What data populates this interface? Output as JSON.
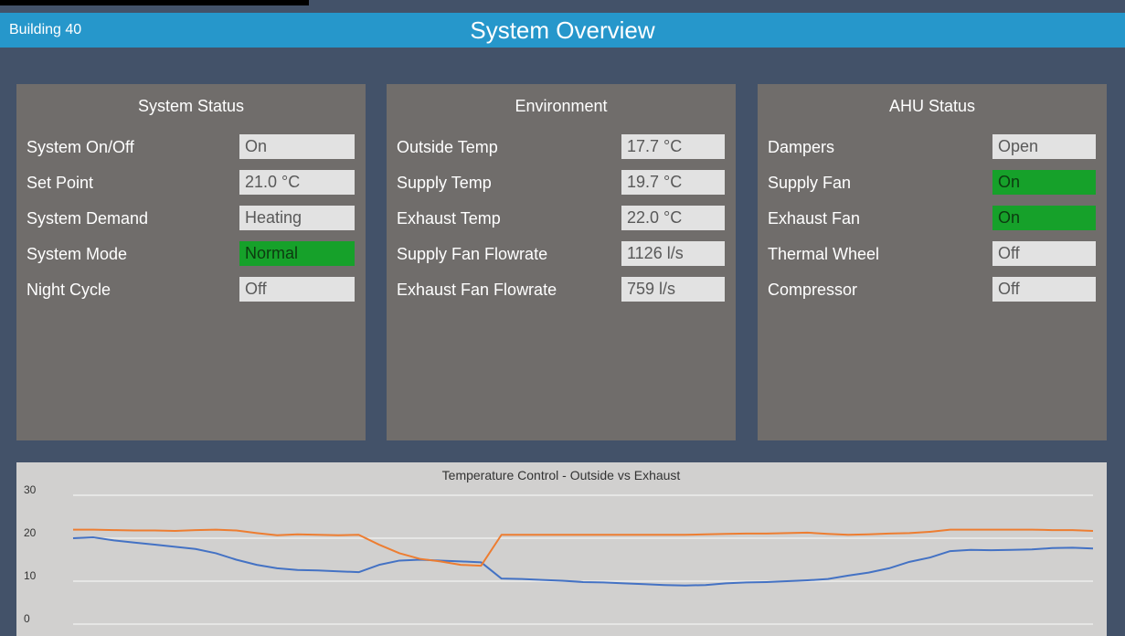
{
  "header": {
    "building": "Building 40",
    "title": "System Overview"
  },
  "panels": {
    "system_status": {
      "title": "System Status",
      "rows": [
        {
          "label": "System On/Off",
          "value": "On"
        },
        {
          "label": "Set Point",
          "value": "21.0 °C"
        },
        {
          "label": "System Demand",
          "value": "Heating"
        },
        {
          "label": "System Mode",
          "value": "Normal"
        },
        {
          "label": "Night Cycle",
          "value": "Off"
        }
      ]
    },
    "environment": {
      "title": "Environment",
      "rows": [
        {
          "label": "Outside Temp",
          "value": "17.7 °C"
        },
        {
          "label": "Supply Temp",
          "value": "19.7 °C"
        },
        {
          "label": "Exhaust Temp",
          "value": "22.0 °C"
        },
        {
          "label": "Supply Fan Flowrate",
          "value": "1126 l/s"
        },
        {
          "label": "Exhaust Fan Flowrate",
          "value": "759 l/s"
        }
      ]
    },
    "ahu_status": {
      "title": "AHU Status",
      "rows": [
        {
          "label": "Dampers",
          "value": "Open"
        },
        {
          "label": "Supply Fan",
          "value": "On"
        },
        {
          "label": "Exhaust Fan",
          "value": "On"
        },
        {
          "label": "Thermal Wheel",
          "value": "Off"
        },
        {
          "label": "Compressor",
          "value": "Off"
        }
      ]
    }
  },
  "colors": {
    "active_green": "#16a12a",
    "outside_series": "#4472c4",
    "exhaust_series": "#ed7d31"
  },
  "chart_data": {
    "type": "line",
    "title": "Temperature Control - Outside vs Exhaust",
    "ylim": [
      0,
      30
    ],
    "yticks": [
      0,
      10,
      20,
      30
    ],
    "grid": true,
    "x": [
      0,
      2,
      4,
      6,
      8,
      10,
      12,
      14,
      16,
      18,
      20,
      22,
      24,
      26,
      28,
      30,
      32,
      34,
      36,
      38,
      40,
      42,
      44,
      46,
      48,
      50,
      52,
      54,
      56,
      58,
      60,
      62,
      64,
      66,
      68,
      70,
      72,
      74,
      76,
      78,
      80,
      82,
      84,
      86,
      88,
      90,
      92,
      94,
      96,
      98,
      100
    ],
    "series": [
      {
        "values": [
          20.0,
          20.2,
          19.5,
          19.0,
          18.5,
          18.0,
          17.5,
          16.5,
          15.0,
          13.8,
          13.0,
          12.6,
          12.5,
          12.3,
          12.1,
          13.8,
          14.8,
          15.0,
          14.8,
          14.6,
          14.4,
          10.6,
          10.5,
          10.3,
          10.1,
          9.8,
          9.7,
          9.5,
          9.3,
          9.1,
          9.0,
          9.1,
          9.5,
          9.7,
          9.8,
          10.0,
          10.2,
          10.5,
          11.3,
          12.0,
          13.0,
          14.5,
          15.5,
          17.0,
          17.3,
          17.2,
          17.3,
          17.4,
          17.7,
          17.8,
          17.6
        ]
      },
      {
        "values": [
          22.0,
          22.0,
          21.9,
          21.8,
          21.8,
          21.7,
          21.9,
          22.0,
          21.8,
          21.2,
          20.7,
          20.9,
          20.8,
          20.7,
          20.8,
          18.5,
          16.5,
          15.2,
          14.6,
          13.8,
          13.6,
          20.8,
          20.8,
          20.8,
          20.8,
          20.8,
          20.8,
          20.8,
          20.8,
          20.8,
          20.8,
          20.9,
          21.0,
          21.1,
          21.1,
          21.2,
          21.3,
          21.0,
          20.8,
          20.9,
          21.1,
          21.2,
          21.5,
          22.0,
          22.0,
          22.0,
          22.0,
          22.0,
          21.9,
          21.9,
          21.7
        ]
      }
    ]
  }
}
